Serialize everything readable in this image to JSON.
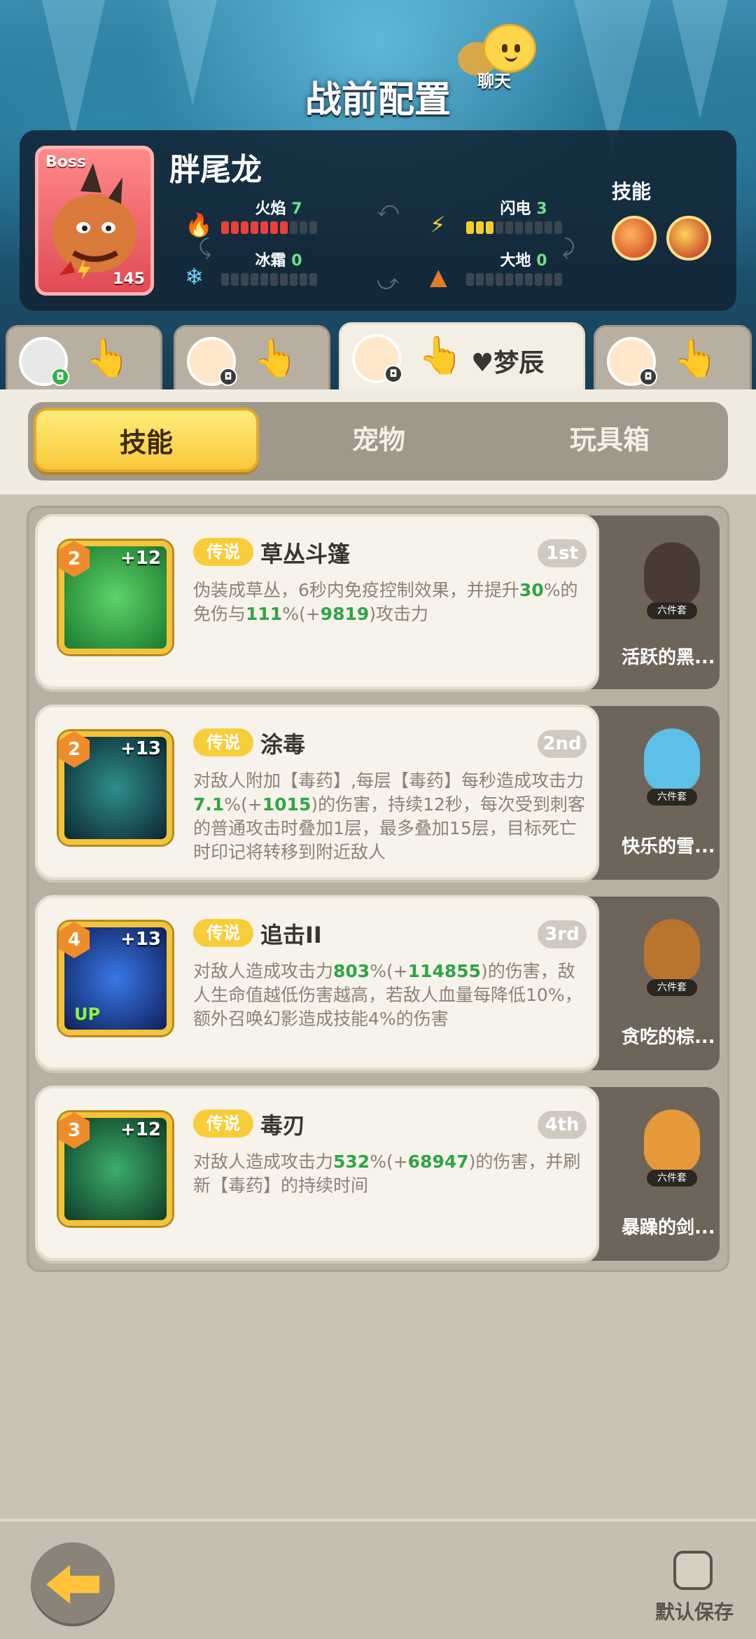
{
  "header": {
    "title": "战前配置",
    "chat_label": "聊天"
  },
  "boss": {
    "tag": "Boss",
    "name": "胖尾龙",
    "level": "145",
    "elements": [
      {
        "name": "火焰",
        "value": "7",
        "max": 10,
        "color": "#e8403a",
        "icon": "fire-icon"
      },
      {
        "name": "闪电",
        "value": "3",
        "max": 10,
        "color": "#f5cf2e",
        "icon": "lightning-icon"
      },
      {
        "name": "冰霜",
        "value": "0",
        "max": 10,
        "color": "#6fd3f2",
        "icon": "snowflake-icon"
      },
      {
        "name": "大地",
        "value": "0",
        "max": 10,
        "color": "#e07b2c",
        "icon": "earth-icon"
      }
    ],
    "skills_label": "技能"
  },
  "party": [
    {
      "name": ""
    },
    {
      "name": ""
    },
    {
      "name": "♥梦辰"
    },
    {
      "name": ""
    }
  ],
  "subtabs": [
    "技能",
    "宠物",
    "玩具箱"
  ],
  "skills": [
    {
      "level": "2",
      "plus": "+12",
      "rarity": "传说",
      "name": "草丛斗篷",
      "rank": "1st",
      "desc": [
        {
          "t": "伪装成草丛，6秒内免疫控制效果，并提升"
        },
        {
          "t": "30",
          "hl": true
        },
        {
          "t": "%的免伤与"
        },
        {
          "t": "111",
          "hl": true
        },
        {
          "t": "%(+"
        },
        {
          "t": "9819",
          "hl": true
        },
        {
          "t": ")攻击力"
        }
      ],
      "pet_name": "活跃的黑...",
      "pet_set": "六件套",
      "icon_color": "#2aa64a"
    },
    {
      "level": "2",
      "plus": "+13",
      "rarity": "传说",
      "name": "涂毒",
      "rank": "2nd",
      "desc": [
        {
          "t": "对敌人附加【毒药】,每层【毒药】每秒造成攻击力"
        },
        {
          "t": "7.1",
          "hl": true
        },
        {
          "t": "%(+"
        },
        {
          "t": "1015",
          "hl": true
        },
        {
          "t": ")的伤害，持续12秒，每次受到刺客的普通攻击时叠加1层，最多叠加15层，目标死亡时印记将转移到附近敌人"
        }
      ],
      "pet_name": "快乐的雪...",
      "pet_set": "六件套",
      "icon_color": "#153f4a"
    },
    {
      "level": "4",
      "plus": "+13",
      "rarity": "传说",
      "name": "追击II",
      "rank": "3rd",
      "up": "UP",
      "desc": [
        {
          "t": "对敌人造成攻击力"
        },
        {
          "t": "803",
          "hl": true
        },
        {
          "t": "%(+"
        },
        {
          "t": "114855",
          "hl": true
        },
        {
          "t": ")的伤害，敌人生命值越低伤害越高，若敌人血量每降低10%，额外召唤幻影造成技能4%的伤害"
        }
      ],
      "pet_name": "贪吃的棕...",
      "pet_set": "六件套",
      "icon_color": "#1d3c8f"
    },
    {
      "level": "3",
      "plus": "+12",
      "rarity": "传说",
      "name": "毒刃",
      "rank": "4th",
      "desc": [
        {
          "t": "对敌人造成攻击力"
        },
        {
          "t": "532",
          "hl": true
        },
        {
          "t": "%(+"
        },
        {
          "t": "68947",
          "hl": true
        },
        {
          "t": ")的伤害，并刷新【毒药】的持续时间"
        }
      ],
      "pet_name": "暴躁的剑...",
      "pet_set": "六件套",
      "icon_color": "#1f6a45"
    }
  ],
  "bottom": {
    "save_label": "默认保存"
  }
}
